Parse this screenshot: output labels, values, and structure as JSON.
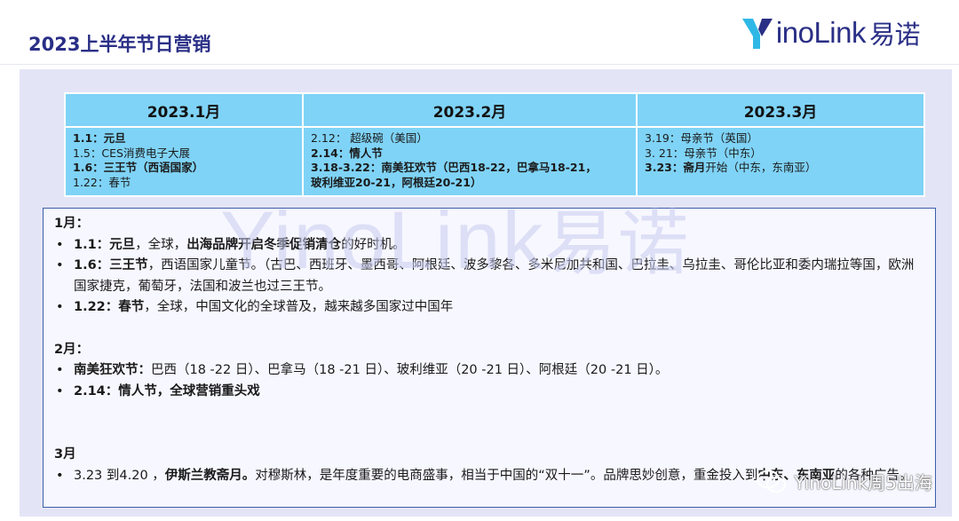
{
  "page": {
    "title": "2023上半年节日营销"
  },
  "logo": {
    "latin": "inoLink",
    "cn": "易诺"
  },
  "watermark": {
    "latin": "YinoLink",
    "cn": "易诺"
  },
  "table": {
    "headers": [
      "2023.1月",
      "2023.2月",
      "2023.3月"
    ],
    "jan": [
      {
        "text": "1.1：元旦",
        "bold": true
      },
      {
        "text": "1.5：CES消费电子大展",
        "bold": false
      },
      {
        "text": "1.6：三王节（西语国家）",
        "bold": true
      },
      {
        "text": "1.22：春节",
        "bold": false
      }
    ],
    "feb": [
      {
        "text": "2.12： 超级碗（美国）",
        "bold": false
      },
      {
        "text": "2.14：情人节",
        "bold": true
      },
      {
        "text": "3.18-3.22：南美狂欢节（巴西18-22，巴拿马18-21，",
        "bold": true
      },
      {
        "text": "玻利维亚20-21，阿根廷20-21）",
        "bold": true
      }
    ],
    "mar": [
      {
        "text": "3.19：母亲节（英国）",
        "bold": false
      },
      {
        "text": "3. 21：母亲节（中东）",
        "bold": false
      },
      {
        "pre": "3.23：斋月",
        "post": "开始（中东，东南亚）"
      }
    ]
  },
  "notes": {
    "jan_title": "1月：",
    "jan_items": [
      {
        "b1": "1.1：元旦",
        "t1": "，全球，",
        "b2": "出海品牌开启冬季促销清仓",
        "t2": "的好时机。"
      },
      {
        "b1": "1.6：三王节",
        "t1": "，西语国家儿童节。（古巴、西班牙、墨西哥、阿根廷、波多黎各、多米尼加共和国、巴拉圭、乌拉圭、哥伦比亚和委内瑞拉等国，欧洲国家捷克，葡萄牙，法国和波兰也过三王节。"
      },
      {
        "b1": "1.22：春节",
        "t1": "，全球，中国文化的全球普及，越来越多国家过中国年"
      }
    ],
    "feb_title": "2月：",
    "feb_items": [
      {
        "b1": "南美狂欢节：",
        "t1": "巴西（18 -22 日）、巴拿马（18 -21 日）、玻利维亚（20 -21 日）、阿根廷（20 -21 日）。"
      },
      {
        "b1": "2.14：情人节，全球营销重头戏"
      }
    ],
    "mar_title": "3月",
    "mar_items": [
      {
        "t0": "3.23 到4.20 ，",
        "b1": "伊斯兰教斋月。",
        "t1": "对穆斯林，是年度重要的电商盛事，相当于中国的“双十一”。品牌",
        "t2": "思妙创意，重金投入到",
        "b2": "中东、东南亚",
        "t3": "的各种广告。"
      }
    ]
  },
  "wechat_watermark": "YinoLink周5出海"
}
